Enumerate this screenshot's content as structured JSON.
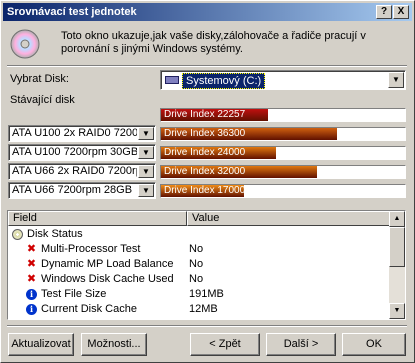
{
  "window": {
    "title": "Srovnávací test jednotek",
    "help_btn": "?",
    "close_btn": "X"
  },
  "intro_text": "Toto okno ukazuje,jak vaše disky,zálohovače a řadiče pracují v porovnání s jinými Windows systémy.",
  "select_disk": {
    "label": "Vybrat Disk:",
    "value": "Systemový (C:)"
  },
  "current_disk_label": "Stávající disk",
  "bars": [
    {
      "label": "",
      "text": "Drive Index 22257",
      "fraction": 0.44,
      "color": "#c01010"
    },
    {
      "label": "ATA U100 2x RAID0 7200rpm",
      "text": "Drive Index 36300",
      "fraction": 0.72,
      "color": "#d06010"
    },
    {
      "label": "ATA U100 7200rpm 30GB",
      "text": "Drive Index 24000",
      "fraction": 0.47,
      "color": "#e07810"
    },
    {
      "label": "ATA U66 2x RAID0 7200rpm",
      "text": "Drive Index 32000",
      "fraction": 0.64,
      "color": "#e07810"
    },
    {
      "label": "ATA U66 7200rpm 28GB",
      "text": "Drive Index 17000",
      "fraction": 0.34,
      "color": "#f08c18"
    }
  ],
  "list": {
    "columns": [
      "Field",
      "Value"
    ],
    "rows": [
      {
        "icon": "cd-icon",
        "name": "Disk Status",
        "value": ""
      },
      {
        "icon": "x-icon",
        "name": "Multi-Processor Test",
        "value": "No"
      },
      {
        "icon": "x-icon",
        "name": "Dynamic MP Load Balance",
        "value": "No"
      },
      {
        "icon": "x-icon",
        "name": "Windows Disk Cache Used",
        "value": "No"
      },
      {
        "icon": "info-icon",
        "name": "Test File Size",
        "value": "191MB"
      },
      {
        "icon": "info-icon",
        "name": "Current Disk Cache",
        "value": "12MB"
      }
    ]
  },
  "buttons": {
    "refresh": "Aktualizovat",
    "options": "Možnosti...",
    "back": "< Zpět",
    "next": "Další >",
    "ok": "OK"
  }
}
